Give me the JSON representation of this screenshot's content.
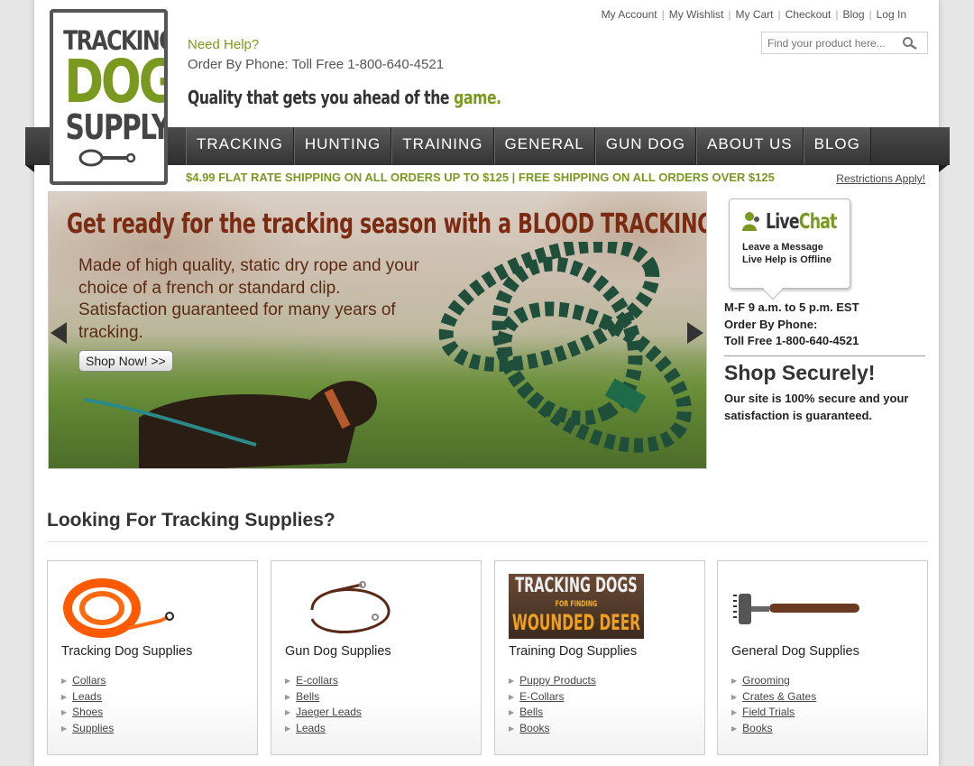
{
  "top_links": [
    "My Account",
    "My Wishlist",
    "My Cart",
    "Checkout",
    "Blog",
    "Log In"
  ],
  "search": {
    "placeholder": "Find your product here..."
  },
  "logo": {
    "line1": "TRACKING",
    "line2": "DOG",
    "line3": "SUPPLY"
  },
  "header": {
    "need_help": "Need Help?",
    "phone": "Order By Phone: Toll Free 1-800-640-4521",
    "tagline_main": "Quality that gets you ahead of the ",
    "tagline_accent": "game."
  },
  "nav": [
    "TRACKING",
    "HUNTING",
    "TRAINING",
    "GENERAL",
    "GUN DOG",
    "ABOUT US",
    "BLOG"
  ],
  "shipping": {
    "text": "$4.99 FLAT RATE SHIPPING ON ALL ORDERS UP TO $125 | FREE SHIPPING ON ALL ORDERS OVER $125",
    "restrictions": "Restrictions Apply!"
  },
  "banner": {
    "headline": "Get ready for the tracking season with a BLOOD TRACKING ROPE LEAD.",
    "body": "Made of high quality, static dry rope and your choice of a french or standard clip. Satisfaction guaranteed for many years of tracking.",
    "cta": "Shop Now! >>"
  },
  "livechat": {
    "name_a": "Live",
    "name_b": "Chat",
    "msg1": "Leave a Message",
    "msg2": "Live Help is Offline"
  },
  "sidebar": {
    "hours": "M-F 9 a.m. to 5 p.m. EST",
    "order_label": "Order By Phone:",
    "order_phone": "Toll Free 1-800-640-4521",
    "secure_title": "Shop Securely!",
    "secure_text": "Our site is 100% secure and your satisfaction is guaranteed."
  },
  "section": {
    "title": "Looking For Tracking Supplies?"
  },
  "cards": [
    {
      "title": "Tracking Dog Supplies",
      "links": [
        "Collars",
        "Leads",
        "Shoes",
        "Supplies"
      ]
    },
    {
      "title": "Gun Dog Supplies",
      "links": [
        "E-collars",
        "Bells",
        "Jaeger Leads",
        "Leads"
      ]
    },
    {
      "title": "Training Dog Supplies",
      "links": [
        "Puppy Products",
        "E-Collars",
        "Bells",
        "Books"
      ],
      "thumb_text": [
        "TRACKING DOGS",
        "FOR FINDING",
        "WOUNDED DEER"
      ]
    },
    {
      "title": "General Dog Supplies",
      "links": [
        "Grooming",
        "Crates & Gates",
        "Field Trials",
        "Books"
      ]
    }
  ],
  "colors": {
    "brand_green": "#7a9a1f",
    "nav_dark": "#333333",
    "banner_red": "#7a2b12"
  }
}
